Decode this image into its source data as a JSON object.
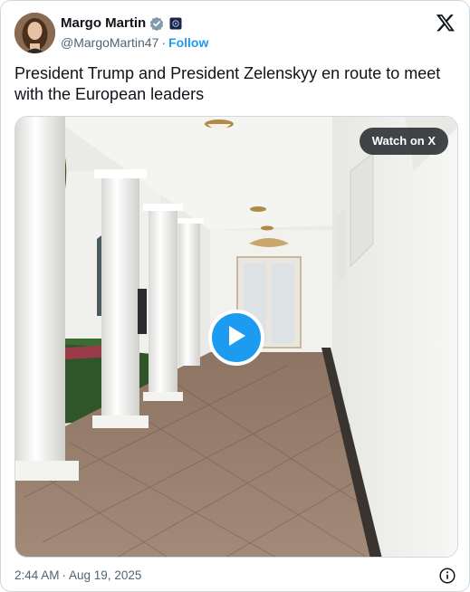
{
  "author": {
    "display_name": "Margo Martin",
    "handle": "@MargoMartin47",
    "separator": "·",
    "follow_label": "Follow"
  },
  "tweet": {
    "text": "President Trump and President Zelenskyy en route to meet with the European leaders"
  },
  "media": {
    "watch_label": "Watch on X"
  },
  "footer": {
    "time": "2:44 AM",
    "separator": "·",
    "date": "Aug 19, 2025"
  },
  "icons": {
    "verified": "verified-badge-icon",
    "affiliation": "affiliation-badge-icon",
    "brand": "x-logo-icon",
    "play": "play-icon",
    "info": "info-icon"
  },
  "colors": {
    "accent": "#1d9bf0",
    "text_primary": "#0f1419",
    "text_secondary": "#536471",
    "border": "#cfd9de"
  }
}
